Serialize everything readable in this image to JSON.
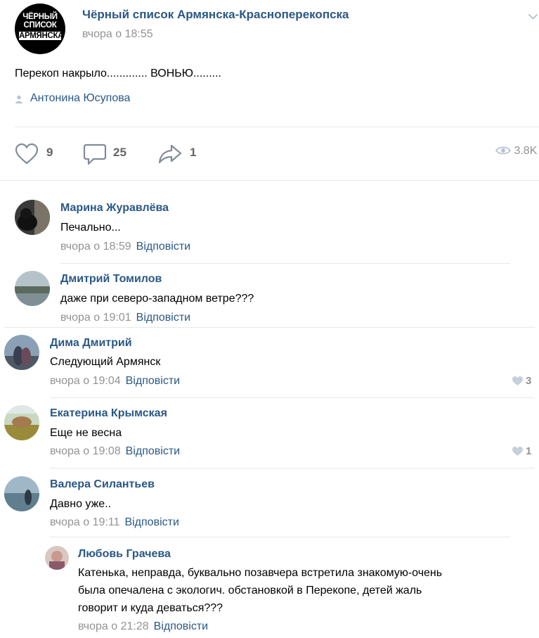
{
  "post": {
    "group_name": "Чёрный список Армянска-Красноперекопска",
    "time": "вчора о 18:55",
    "logo_lines": [
      "ЧЁРНЫЙ",
      "СПИСОК",
      "АРМЯНСКА"
    ],
    "text": "Перекоп накрыло............. ВОНЬЮ.........",
    "author": "Антонина Юсупова",
    "likes": "9",
    "comments": "25",
    "shares": "1",
    "views": "3.8K"
  },
  "comments": [
    {
      "name": "Марина Журавлёва",
      "text": "Печально...",
      "time": "вчора о 18:59",
      "reply": "Відповісти"
    },
    {
      "name": "Дмитрий Томилов",
      "text": "даже при северо-западном ветре???",
      "time": "вчора о 19:01",
      "reply": "Відповісти"
    },
    {
      "name": "Дима Дмитрий",
      "text": "Следующий Армянск",
      "time": "вчора о 19:04",
      "reply": "Відповісти",
      "likes": "3"
    },
    {
      "name": "Екатерина Крымская",
      "text": "Еще не весна",
      "time": "вчора о 19:08",
      "reply": "Відповісти",
      "likes": "1"
    },
    {
      "name": "Валера Силантьев",
      "text": "Давно уже..",
      "time": "вчора о 19:11",
      "reply": "Відповісти"
    },
    {
      "name": "Любовь Грачева",
      "lines": [
        "Катенька, неправда, буквально позавчера встретила знакомую-очень",
        "была опечалена с экологич. обстановкой в Перекопе, детей жаль",
        "говорит и куда деваться???"
      ],
      "time": "вчора о 21:28",
      "reply": "Відповісти"
    }
  ],
  "colors": {
    "link": "#2a5885",
    "meta": "#939393",
    "divider": "#e7e8ec",
    "icon": "#b8c3d1"
  },
  "icons": [
    "chevron-down-icon",
    "person-icon",
    "heart-icon",
    "comment-icon",
    "share-icon",
    "eye-icon",
    "small-heart-icon"
  ]
}
